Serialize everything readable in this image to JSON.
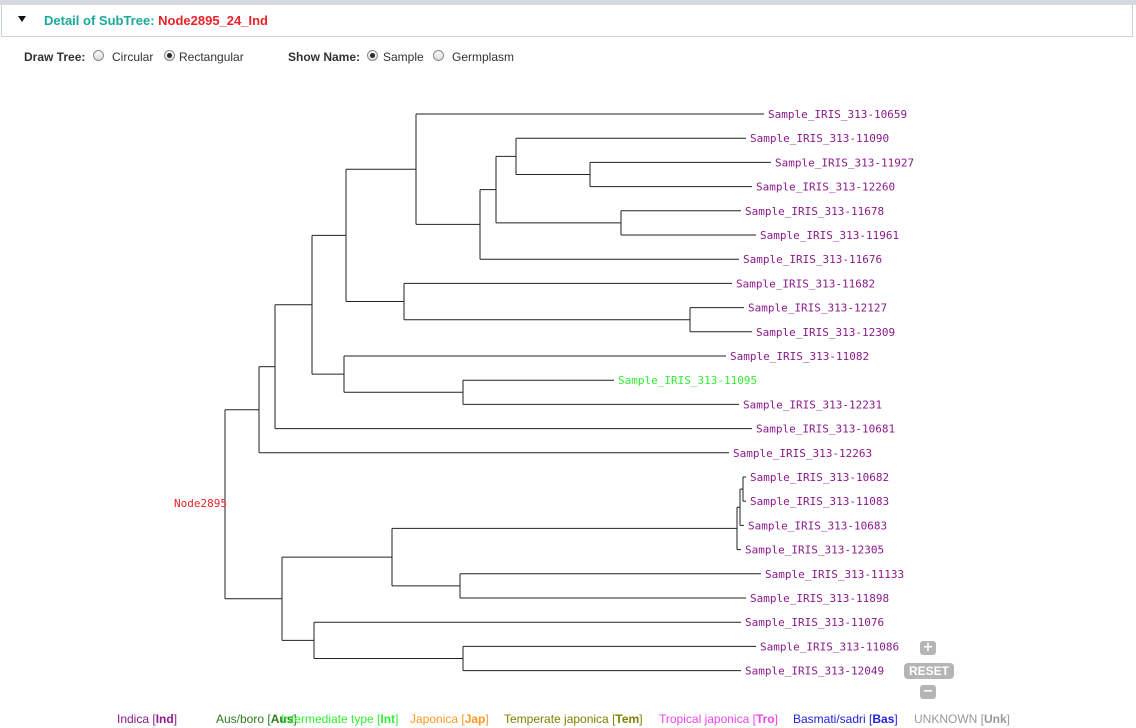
{
  "panel": {
    "title_prefix": "Detail of SubTree: ",
    "node_name": "Node2895_24_Ind"
  },
  "controls": {
    "draw_tree_label": "Draw Tree:",
    "draw_options": [
      {
        "label": "Circular",
        "checked": false
      },
      {
        "label": "Rectangular",
        "checked": true
      }
    ],
    "show_name_label": "Show Name:",
    "name_options": [
      {
        "label": "Sample",
        "checked": true
      },
      {
        "label": "Germplasm",
        "checked": false
      }
    ]
  },
  "tree": {
    "root_label": "Node2895",
    "root_color": "#e8242b",
    "indica_color": "#8b1a8b",
    "intermediate_color": "#33ee33",
    "leaves": [
      {
        "label": "Sample_IRIS_313-10659",
        "group": "Ind"
      },
      {
        "label": "Sample_IRIS_313-11090",
        "group": "Ind"
      },
      {
        "label": "Sample_IRIS_313-11927",
        "group": "Ind"
      },
      {
        "label": "Sample_IRIS_313-12260",
        "group": "Ind"
      },
      {
        "label": "Sample_IRIS_313-11678",
        "group": "Ind"
      },
      {
        "label": "Sample_IRIS_313-11961",
        "group": "Ind"
      },
      {
        "label": "Sample_IRIS_313-11676",
        "group": "Ind"
      },
      {
        "label": "Sample_IRIS_313-11682",
        "group": "Ind"
      },
      {
        "label": "Sample_IRIS_313-12127",
        "group": "Ind"
      },
      {
        "label": "Sample_IRIS_313-12309",
        "group": "Ind"
      },
      {
        "label": "Sample_IRIS_313-11082",
        "group": "Ind"
      },
      {
        "label": "Sample_IRIS_313-11095",
        "group": "Int"
      },
      {
        "label": "Sample_IRIS_313-12231",
        "group": "Ind"
      },
      {
        "label": "Sample_IRIS_313-10681",
        "group": "Ind"
      },
      {
        "label": "Sample_IRIS_313-12263",
        "group": "Ind"
      },
      {
        "label": "Sample_IRIS_313-10682",
        "group": "Ind"
      },
      {
        "label": "Sample_IRIS_313-11083",
        "group": "Ind"
      },
      {
        "label": "Sample_IRIS_313-10683",
        "group": "Ind"
      },
      {
        "label": "Sample_IRIS_313-12305",
        "group": "Ind"
      },
      {
        "label": "Sample_IRIS_313-11133",
        "group": "Ind"
      },
      {
        "label": "Sample_IRIS_313-11898",
        "group": "Ind"
      },
      {
        "label": "Sample_IRIS_313-11076",
        "group": "Ind"
      },
      {
        "label": "Sample_IRIS_313-11086",
        "group": "Ind"
      },
      {
        "label": "Sample_IRIS_313-12049",
        "group": "Ind"
      }
    ]
  },
  "zoom": {
    "plus": "+",
    "reset": "RESET",
    "minus": "−"
  },
  "legend": [
    {
      "name": "Indica",
      "code": "Ind",
      "color": "#8b1a8b"
    },
    {
      "name": "Aus/boro",
      "code": "Aus",
      "color": "#2e7d1e"
    },
    {
      "name": "Intermediate type",
      "code": "Int",
      "color": "#33ee33"
    },
    {
      "name": "Japonica",
      "code": "Jap",
      "color": "#ff9922"
    },
    {
      "name": "Temperate japonica",
      "code": "Tem",
      "color": "#808000"
    },
    {
      "name": "Tropical japonica",
      "code": "Tro",
      "color": "#ee44ee"
    },
    {
      "name": "Basmati/sadri",
      "code": "Bas",
      "color": "#2222dd"
    },
    {
      "name": "UNKNOWN",
      "code": "Unk",
      "color": "#999999"
    }
  ]
}
